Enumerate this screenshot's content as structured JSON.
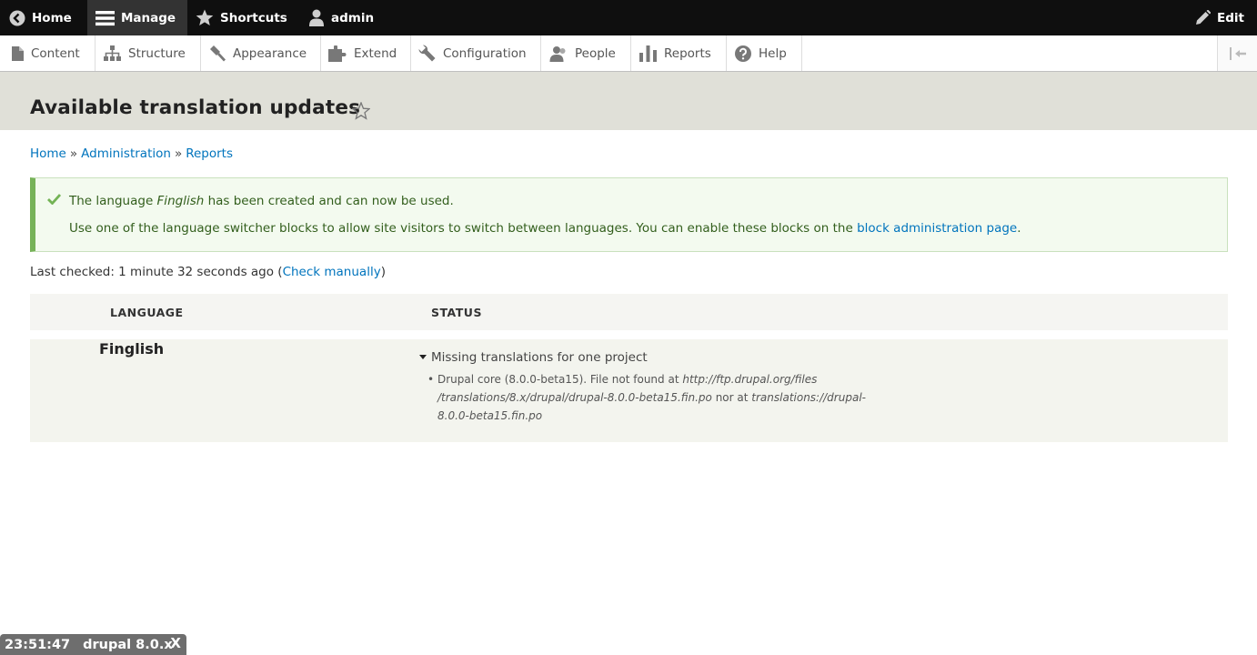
{
  "toolbar": {
    "home": "Home",
    "manage": "Manage",
    "shortcuts": "Shortcuts",
    "user": "admin",
    "edit": "Edit"
  },
  "tray": {
    "items": [
      {
        "label": "Content"
      },
      {
        "label": "Structure"
      },
      {
        "label": "Appearance"
      },
      {
        "label": "Extend"
      },
      {
        "label": "Configuration"
      },
      {
        "label": "People"
      },
      {
        "label": "Reports"
      },
      {
        "label": "Help"
      }
    ]
  },
  "page": {
    "title": "Available translation updates"
  },
  "breadcrumb": {
    "home": "Home",
    "administration": "Administration",
    "reports": "Reports",
    "separator": "»"
  },
  "message": {
    "line1_pre": "The language ",
    "line1_lang": "Finglish",
    "line1_post": " has been created and can now be used.",
    "line2_pre": "Use one of the language switcher blocks to allow site visitors to switch between languages. You can enable these blocks on the ",
    "line2_link": "block administration page",
    "line2_post": "."
  },
  "last_checked": {
    "prefix": "Last checked: 1 minute 32 seconds ago (",
    "link": "Check manually",
    "suffix": ")"
  },
  "table": {
    "headers": {
      "language": "LANGUAGE",
      "status": "STATUS"
    },
    "rows": [
      {
        "language": "Finglish",
        "summary": "Missing translations for one project",
        "detail_pre": "Drupal core (8.0.0-beta15). File not found at ",
        "detail_path1": "http://ftp.drupal.org/files /translations/8.x/drupal/drupal-8.0.0-beta15.fin.po",
        "detail_mid": " nor at ",
        "detail_path2": "translations://drupal-8.0.0-beta15.fin.po"
      }
    ]
  },
  "devbar": {
    "time": "23:51:47",
    "site": "drupal 8.0.x",
    "close": "X"
  },
  "colors": {
    "toolbar_bg": "#0f0f0f",
    "link": "#0074bd",
    "message_border": "#77b259",
    "message_bg": "#f3faef"
  }
}
